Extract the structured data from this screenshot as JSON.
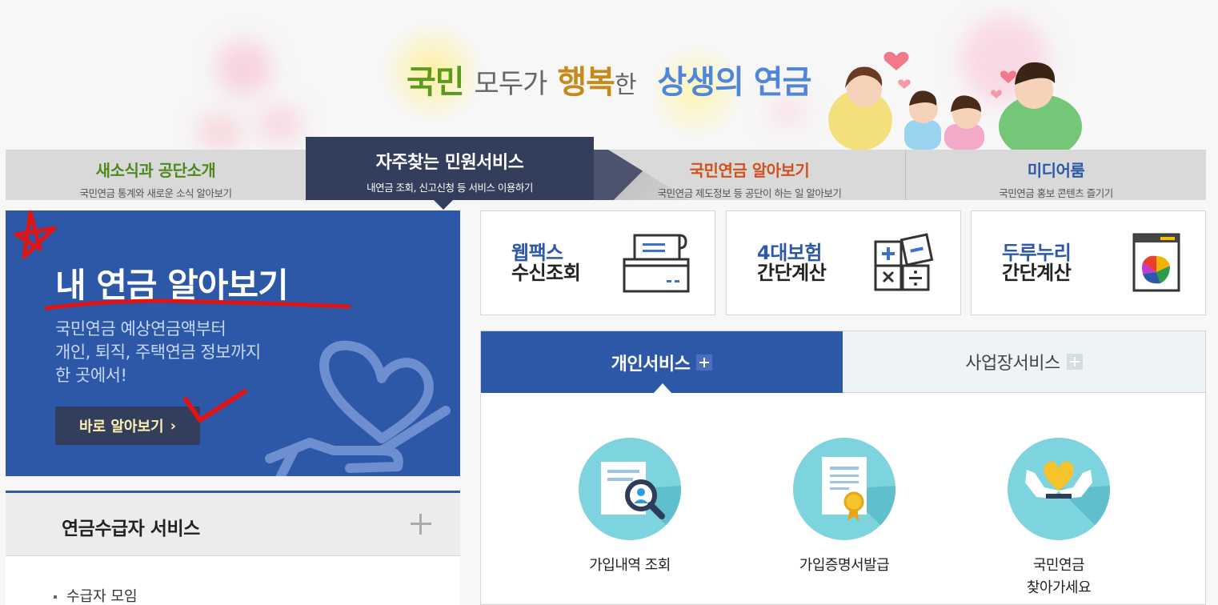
{
  "banner": {
    "slogan_1": "국민",
    "slogan_2": "모두가",
    "slogan_3": "행복",
    "slogan_4": "한",
    "slogan_5": "상생의 연금"
  },
  "nav": {
    "tabs": [
      {
        "title": "새소식과 공단소개",
        "subtitle": "국민연금 통계와 새로운 소식 알아보기",
        "color": "#4e8a1e"
      },
      {
        "title": "자주찾는 민원서비스",
        "subtitle": "내연금 조회, 신고신청 등 서비스 이용하기",
        "color": "#ffffff"
      },
      {
        "title": "국민연금 알아보기",
        "subtitle": "국민연금 제도정보 등 공단이 하는 일 알아보기",
        "color": "#d2501b"
      },
      {
        "title": "미디어룸",
        "subtitle": "국민연금 홍보 콘텐츠 즐기기",
        "color": "#2d58a8"
      }
    ]
  },
  "hero": {
    "title": "내 연금 알아보기",
    "desc_1": "국민연금 예상연금액부터",
    "desc_2": "개인, 퇴직, 주택연금 정보까지",
    "desc_3": "한 곳에서!",
    "button": "바로 알아보기",
    "button_chevron": "›"
  },
  "accordion": {
    "title": "연금수급자 서비스",
    "items": [
      "수급자 모임"
    ]
  },
  "quick": [
    {
      "line1": "웹팩스",
      "line2": "수신조회",
      "icon": "fax-icon"
    },
    {
      "line1": "4대보험",
      "line2": "간단계산",
      "icon": "calculator-icon"
    },
    {
      "line1": "두루누리",
      "line2": "간단계산",
      "icon": "durunuri-icon"
    }
  ],
  "services": {
    "tabs": [
      "개인서비스",
      "사업장서비스"
    ],
    "items": [
      {
        "label": "가입내역 조회",
        "icon": "search-document-icon"
      },
      {
        "label": "가입증명서발급",
        "icon": "certificate-icon"
      },
      {
        "label_1": "국민연금",
        "label_2": "찾아가세요",
        "icon": "heart-hands-icon"
      }
    ]
  },
  "colors": {
    "primary_blue": "#2d58a8",
    "nav_active": "#333d5c",
    "button_text": "#fff2b0",
    "annotation_red": "#e01414"
  }
}
